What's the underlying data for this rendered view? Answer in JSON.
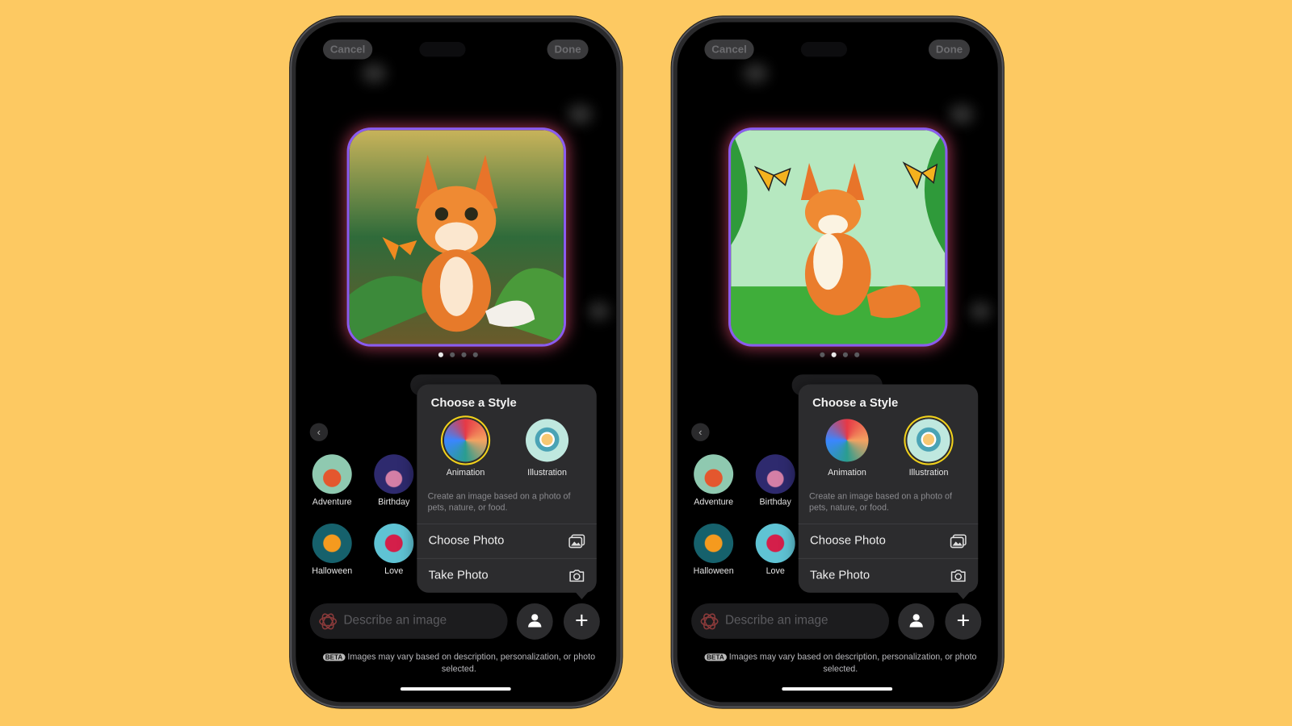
{
  "background_color": "#fdc962",
  "phones": [
    {
      "top_bar": {
        "cancel_label": "Cancel",
        "done_label": "Done"
      },
      "image": {
        "subject": "cartoon fox in jungle with butterfly",
        "style": "animation"
      },
      "page_dots": {
        "count": 4,
        "active_index": 0
      },
      "categories": [
        {
          "label": "Adventure",
          "icon": "jeep-icon"
        },
        {
          "label": "Birthday",
          "icon": "cake-icon"
        },
        {
          "label": "Halloween",
          "icon": "pumpkin-icon"
        },
        {
          "label": "Love",
          "icon": "heart-icon"
        }
      ],
      "style_popup": {
        "title": "Choose a Style",
        "styles": [
          {
            "label": "Animation",
            "selected": true
          },
          {
            "label": "Illustration",
            "selected": false
          }
        ],
        "description": "Create an image based on a photo of pets, nature, or food.",
        "actions": [
          {
            "label": "Choose Photo",
            "icon": "photo-library-icon"
          },
          {
            "label": "Take Photo",
            "icon": "camera-icon"
          }
        ]
      },
      "prompt": {
        "placeholder": "Describe an image"
      },
      "footer": {
        "badge": "BETA",
        "text": "Images may vary based on description, personalization, or photo selected."
      }
    },
    {
      "top_bar": {
        "cancel_label": "Cancel",
        "done_label": "Done"
      },
      "image": {
        "subject": "illustrated fox in jungle with butterflies",
        "style": "illustration"
      },
      "page_dots": {
        "count": 4,
        "active_index": 1
      },
      "categories": [
        {
          "label": "Adventure",
          "icon": "jeep-icon"
        },
        {
          "label": "Birthday",
          "icon": "cake-icon"
        },
        {
          "label": "Halloween",
          "icon": "pumpkin-icon"
        },
        {
          "label": "Love",
          "icon": "heart-icon"
        }
      ],
      "style_popup": {
        "title": "Choose a Style",
        "styles": [
          {
            "label": "Animation",
            "selected": false
          },
          {
            "label": "Illustration",
            "selected": true
          }
        ],
        "description": "Create an image based on a photo of pets, nature, or food.",
        "actions": [
          {
            "label": "Choose Photo",
            "icon": "photo-library-icon"
          },
          {
            "label": "Take Photo",
            "icon": "camera-icon"
          }
        ]
      },
      "prompt": {
        "placeholder": "Describe an image"
      },
      "footer": {
        "badge": "BETA",
        "text": "Images may vary based on description, personalization, or photo selected."
      }
    }
  ]
}
